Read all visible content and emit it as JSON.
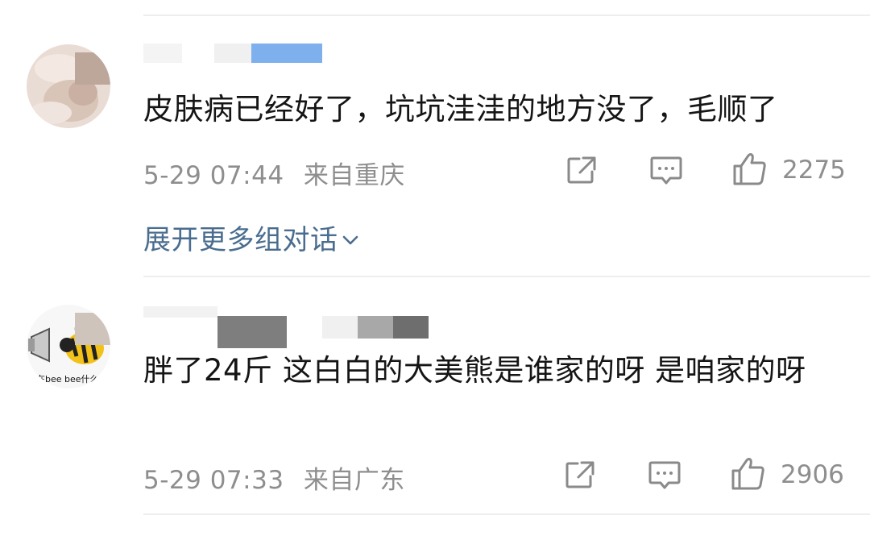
{
  "comments": [
    {
      "text": "皮肤病已经好了，坑坑洼洼的地方没了，毛顺了",
      "date": "5-29 07:44",
      "location": "来自重庆",
      "likes": "2275",
      "expand_label": "展开更多组对话"
    },
    {
      "text": "胖了24斤 这白白的大美熊是谁家的呀 是咱家的呀",
      "date": "5-29 07:33",
      "location": "来自广东",
      "likes": "2906",
      "avatar_text": "在bee bee什么"
    }
  ],
  "colors": {
    "text": "#151515",
    "meta": "#8e8e8e",
    "link": "#4a6d8f",
    "divider": "#eeeeee",
    "name_redaction_blue": "#7fb0ee"
  },
  "icons": [
    "share-icon",
    "comment-icon",
    "like-icon",
    "chevron-down-icon"
  ]
}
